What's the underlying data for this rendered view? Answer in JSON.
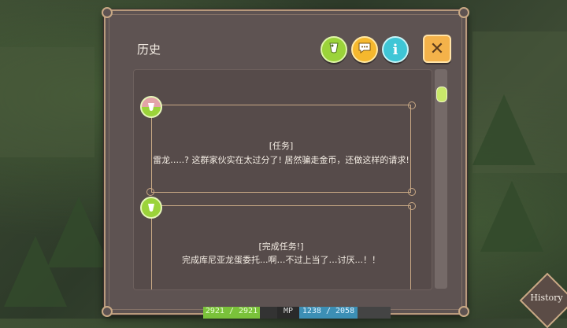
{
  "panel": {
    "title": "历史",
    "buttons": {
      "auto": "auto-icon",
      "chat": "chat-bubble-icon",
      "info_label": "i",
      "close_label": "✕"
    }
  },
  "entries": [
    {
      "label": "[任务]",
      "text": "雷龙…..? 这群家伙实在太过分了! 居然骗走金币，还做这样的请求!"
    },
    {
      "label": "[完成任务!]",
      "text": "完成库尼亚龙蛋委托...啊…不过上当了…讨厌...！！"
    }
  ],
  "hud": {
    "hp": "2921 / 2921",
    "mp_label": "MP",
    "mp": "1238 / 2058"
  },
  "history_button": "History",
  "colors": {
    "panel_bg": "#5e5352",
    "frame": "#b89a7c",
    "accent_green": "#9bd33a",
    "accent_yellow": "#f5b82e",
    "accent_cyan": "#3fc6d6",
    "close_orange": "#f4b24a"
  }
}
